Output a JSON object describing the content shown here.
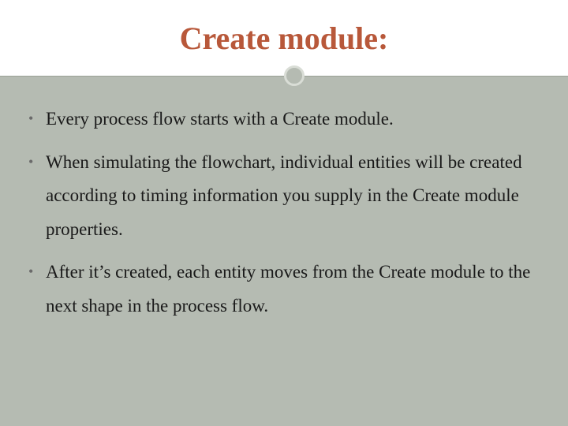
{
  "title": "Create module:",
  "bullets": [
    "Every process flow starts with a Create module.",
    "When simulating the flowchart, individual entities will be created according to timing information you supply in the Create module properties.",
    "After it’s created, each entity moves from the Create module to the next shape in the process flow."
  ]
}
